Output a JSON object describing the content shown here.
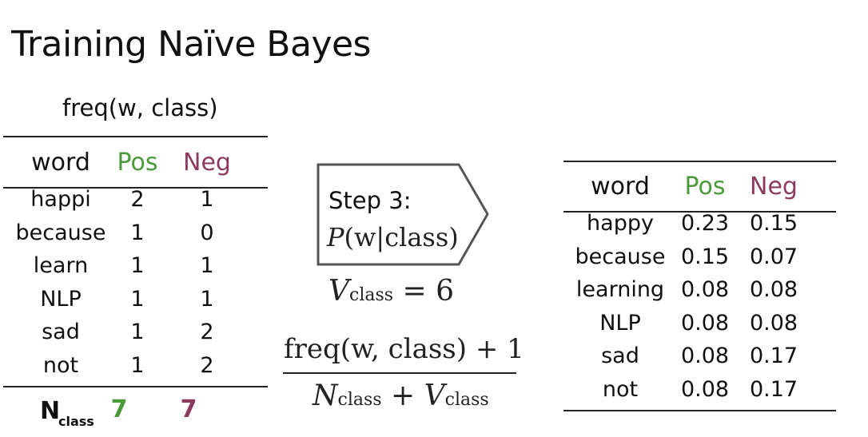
{
  "title": "Training Naïve Bayes",
  "left_table": {
    "caption": "freq(w, class)",
    "headers": {
      "word": "word",
      "pos": "Pos",
      "neg": "Neg"
    },
    "rows": [
      {
        "word": "happi",
        "pos": "2",
        "neg": "1"
      },
      {
        "word": "because",
        "pos": "1",
        "neg": "0"
      },
      {
        "word": "learn",
        "pos": "1",
        "neg": "1"
      },
      {
        "word": "NLP",
        "pos": "1",
        "neg": "1"
      },
      {
        "word": "sad",
        "pos": "1",
        "neg": "2"
      },
      {
        "word": "not",
        "pos": "1",
        "neg": "2"
      }
    ],
    "nclass": {
      "label": "N",
      "label_sub": "class",
      "pos": "7",
      "neg": "7"
    }
  },
  "middle": {
    "step_label": "Step 3:",
    "prob_P": "P",
    "prob_args": "(w|class)",
    "vclass_V": "V",
    "vclass_sub": "class",
    "vclass_eq": "= 6",
    "numerator": "freq(w, class) + 1",
    "den_N": "N",
    "den_N_sub": "class",
    "den_plus": "+",
    "den_V": "V",
    "den_V_sub": "class"
  },
  "right_table": {
    "headers": {
      "word": "word",
      "pos": "Pos",
      "neg": "Neg"
    },
    "rows": [
      {
        "word": "happy",
        "pos": "0.23",
        "neg": "0.15"
      },
      {
        "word": "because",
        "pos": "0.15",
        "neg": "0.07"
      },
      {
        "word": "learning",
        "pos": "0.08",
        "neg": "0.08"
      },
      {
        "word": "NLP",
        "pos": "0.08",
        "neg": "0.08"
      },
      {
        "word": "sad",
        "pos": "0.08",
        "neg": "0.17"
      },
      {
        "word": "not",
        "pos": "0.08",
        "neg": "0.17"
      }
    ]
  },
  "colors": {
    "pos": "#4b9a3a",
    "neg": "#8b3a5e"
  }
}
